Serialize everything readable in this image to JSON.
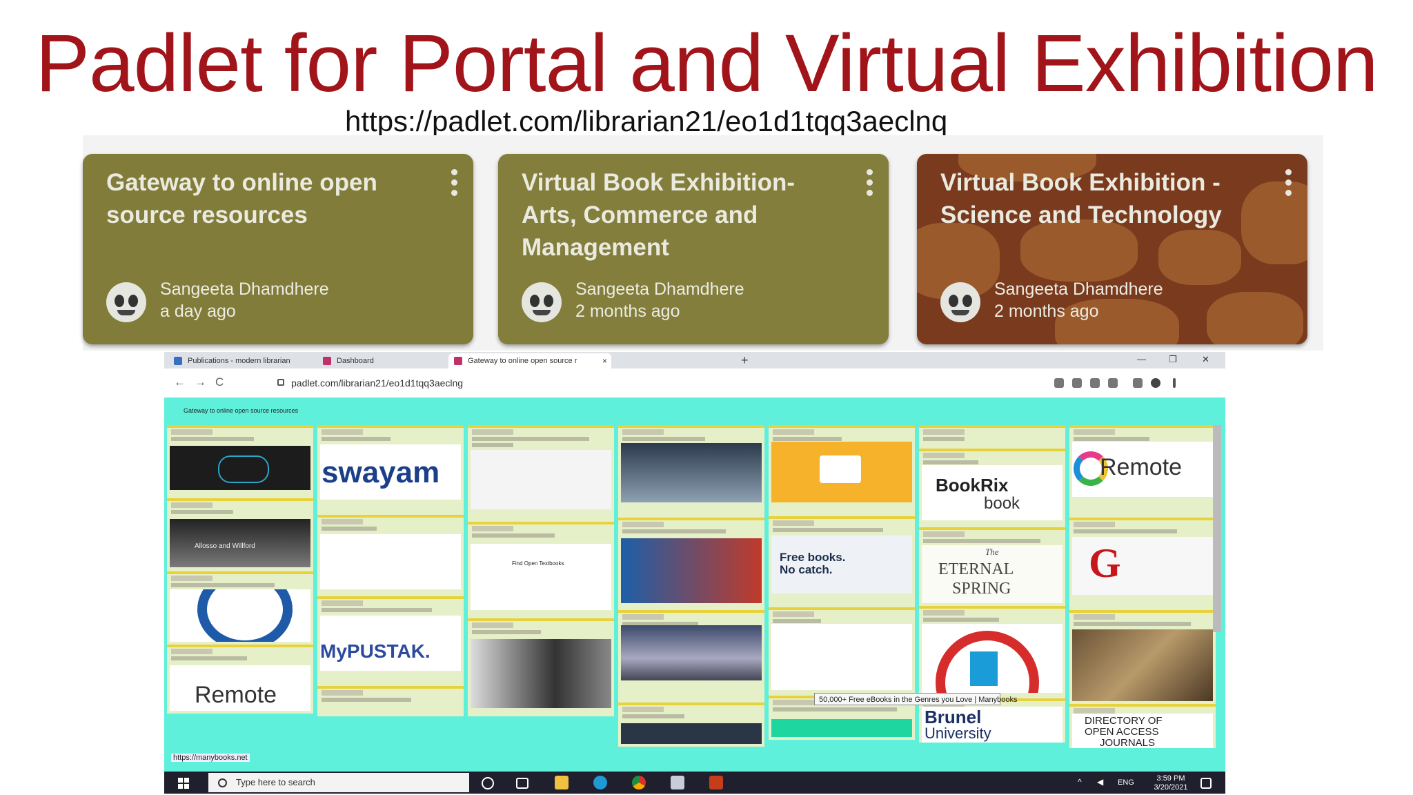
{
  "slide": {
    "title": "Padlet for Portal and Virtual Exhibition",
    "url": "https://padlet.com/librarian21/eo1d1tqq3aeclnq"
  },
  "cards": [
    {
      "title": "Gateway to online open source resources",
      "author": "Sangeeta Dhamdhere",
      "time": "a day ago"
    },
    {
      "title": "Virtual Book Exhibition- Arts, Commerce and Management",
      "author": "Sangeeta Dhamdhere",
      "time": "2 months ago"
    },
    {
      "title": "Virtual Book Exhibition - Science and Technology",
      "author": "Sangeeta Dhamdhere",
      "time": "2 months ago"
    }
  ],
  "browser": {
    "tabs": [
      {
        "label": "Publications - modern librarian",
        "close": "×"
      },
      {
        "label": "Dashboard",
        "close": "×"
      },
      {
        "label": "Gateway to online open source r",
        "close": "×"
      }
    ],
    "new_tab": "+",
    "window_controls": [
      "—",
      "❐",
      "✕"
    ],
    "address": "padlet.com/librarian21/eo1d1tqq3aeclng",
    "nav": {
      "back": "←",
      "forward": "→",
      "reload": "C"
    }
  },
  "padlet": {
    "thumb_labels": {
      "swayam": "swayam",
      "remote": "Remote",
      "allosso": "Allosso and Willford",
      "bookrix_1": "BookRix",
      "bookrix_2": "book",
      "freebooks_1": "Free books.",
      "freebooks_2": "No catch.",
      "eternal_1": "The",
      "eternal_2": "ETERNAL",
      "eternal_3": "SPRING",
      "mypustak": "MyPUSTAK.",
      "brunel_1": "Brunel",
      "brunel_2": "University",
      "doaj_1": "DIRECTORY OF",
      "doaj_2": "OPEN ACCESS",
      "doaj_3": "JOURNALS",
      "find_textbooks": "Find Open Textbooks"
    },
    "tooltip": "50,000+ Free eBooks in the Genres you Love | Manybooks",
    "status_url": "https://manybooks.net"
  },
  "taskbar": {
    "search_placeholder": "Type here to search",
    "lang": "ENG",
    "time": "3:59 PM",
    "date": "3/20/2021"
  }
}
